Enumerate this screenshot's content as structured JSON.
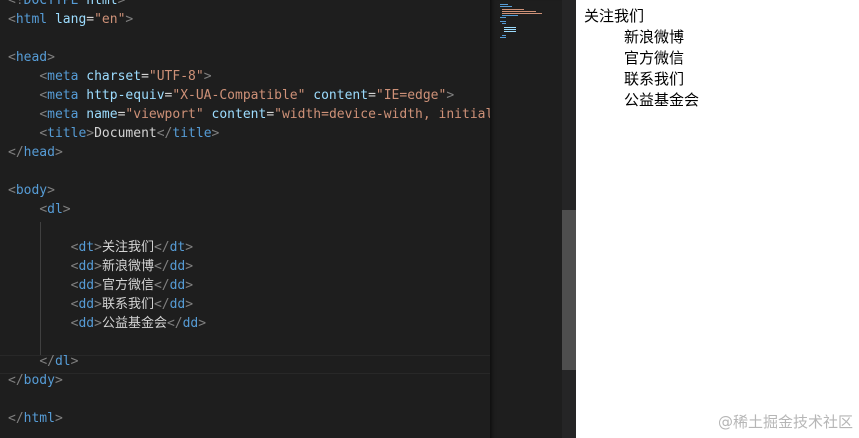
{
  "editor": {
    "lines": [
      [
        {
          "t": "<!",
          "c": "bracket"
        },
        {
          "t": "DOCTYPE",
          "c": "tag"
        },
        {
          "t": " html",
          "c": "attr"
        },
        {
          "t": ">",
          "c": "bracket"
        }
      ],
      [
        {
          "t": "<",
          "c": "bracket"
        },
        {
          "t": "html",
          "c": "tag"
        },
        {
          "t": " lang",
          "c": "attr"
        },
        {
          "t": "=",
          "c": "txt"
        },
        {
          "t": "\"en\"",
          "c": "str"
        },
        {
          "t": ">",
          "c": "bracket"
        }
      ],
      [],
      [
        {
          "t": "<",
          "c": "bracket"
        },
        {
          "t": "head",
          "c": "tag"
        },
        {
          "t": ">",
          "c": "bracket"
        }
      ],
      [
        {
          "t": "    ",
          "c": "txt"
        },
        {
          "t": "<",
          "c": "bracket"
        },
        {
          "t": "meta",
          "c": "tag"
        },
        {
          "t": " charset",
          "c": "attr"
        },
        {
          "t": "=",
          "c": "txt"
        },
        {
          "t": "\"UTF-8\"",
          "c": "str"
        },
        {
          "t": ">",
          "c": "bracket"
        }
      ],
      [
        {
          "t": "    ",
          "c": "txt"
        },
        {
          "t": "<",
          "c": "bracket"
        },
        {
          "t": "meta",
          "c": "tag"
        },
        {
          "t": " http-equiv",
          "c": "attr"
        },
        {
          "t": "=",
          "c": "txt"
        },
        {
          "t": "\"X-UA-Compatible\"",
          "c": "str"
        },
        {
          "t": " content",
          "c": "attr"
        },
        {
          "t": "=",
          "c": "txt"
        },
        {
          "t": "\"IE=edge\"",
          "c": "str"
        },
        {
          "t": ">",
          "c": "bracket"
        }
      ],
      [
        {
          "t": "    ",
          "c": "txt"
        },
        {
          "t": "<",
          "c": "bracket"
        },
        {
          "t": "meta",
          "c": "tag"
        },
        {
          "t": " name",
          "c": "attr"
        },
        {
          "t": "=",
          "c": "txt"
        },
        {
          "t": "\"viewport\"",
          "c": "str"
        },
        {
          "t": " content",
          "c": "attr"
        },
        {
          "t": "=",
          "c": "txt"
        },
        {
          "t": "\"width=device-width, initial-",
          "c": "str"
        }
      ],
      [
        {
          "t": "    ",
          "c": "txt"
        },
        {
          "t": "<",
          "c": "bracket"
        },
        {
          "t": "title",
          "c": "tag"
        },
        {
          "t": ">",
          "c": "bracket"
        },
        {
          "t": "Document",
          "c": "txt"
        },
        {
          "t": "</",
          "c": "bracket"
        },
        {
          "t": "title",
          "c": "tag"
        },
        {
          "t": ">",
          "c": "bracket"
        }
      ],
      [
        {
          "t": "</",
          "c": "bracket"
        },
        {
          "t": "head",
          "c": "tag"
        },
        {
          "t": ">",
          "c": "bracket"
        }
      ],
      [],
      [
        {
          "t": "<",
          "c": "bracket"
        },
        {
          "t": "body",
          "c": "tag"
        },
        {
          "t": ">",
          "c": "bracket"
        }
      ],
      [
        {
          "t": "    ",
          "c": "txt"
        },
        {
          "t": "<",
          "c": "bracket"
        },
        {
          "t": "dl",
          "c": "tag"
        },
        {
          "t": ">",
          "c": "bracket"
        }
      ],
      [],
      [
        {
          "t": "        ",
          "c": "txt"
        },
        {
          "t": "<",
          "c": "bracket"
        },
        {
          "t": "dt",
          "c": "tag"
        },
        {
          "t": ">",
          "c": "bracket"
        },
        {
          "t": "关注我们",
          "c": "txt"
        },
        {
          "t": "</",
          "c": "bracket"
        },
        {
          "t": "dt",
          "c": "tag"
        },
        {
          "t": ">",
          "c": "bracket"
        }
      ],
      [
        {
          "t": "        ",
          "c": "txt"
        },
        {
          "t": "<",
          "c": "bracket"
        },
        {
          "t": "dd",
          "c": "tag"
        },
        {
          "t": ">",
          "c": "bracket"
        },
        {
          "t": "新浪微博",
          "c": "txt"
        },
        {
          "t": "</",
          "c": "bracket"
        },
        {
          "t": "dd",
          "c": "tag"
        },
        {
          "t": ">",
          "c": "bracket"
        }
      ],
      [
        {
          "t": "        ",
          "c": "txt"
        },
        {
          "t": "<",
          "c": "bracket"
        },
        {
          "t": "dd",
          "c": "tag"
        },
        {
          "t": ">",
          "c": "bracket"
        },
        {
          "t": "官方微信",
          "c": "txt"
        },
        {
          "t": "</",
          "c": "bracket"
        },
        {
          "t": "dd",
          "c": "tag"
        },
        {
          "t": ">",
          "c": "bracket"
        }
      ],
      [
        {
          "t": "        ",
          "c": "txt"
        },
        {
          "t": "<",
          "c": "bracket"
        },
        {
          "t": "dd",
          "c": "tag"
        },
        {
          "t": ">",
          "c": "bracket"
        },
        {
          "t": "联系我们",
          "c": "txt"
        },
        {
          "t": "</",
          "c": "bracket"
        },
        {
          "t": "dd",
          "c": "tag"
        },
        {
          "t": ">",
          "c": "bracket"
        }
      ],
      [
        {
          "t": "        ",
          "c": "txt"
        },
        {
          "t": "<",
          "c": "bracket"
        },
        {
          "t": "dd",
          "c": "tag"
        },
        {
          "t": ">",
          "c": "bracket"
        },
        {
          "t": "公益基金会",
          "c": "txt"
        },
        {
          "t": "</",
          "c": "bracket"
        },
        {
          "t": "dd",
          "c": "tag"
        },
        {
          "t": ">",
          "c": "bracket"
        }
      ],
      [],
      [
        {
          "t": "    ",
          "c": "txt"
        },
        {
          "t": "</",
          "c": "bracket"
        },
        {
          "t": "dl",
          "c": "tag"
        },
        {
          "t": ">",
          "c": "bracket"
        }
      ],
      [
        {
          "t": "</",
          "c": "bracket"
        },
        {
          "t": "body",
          "c": "tag"
        },
        {
          "t": ">",
          "c": "bracket"
        }
      ],
      [],
      [
        {
          "t": "</",
          "c": "bracket"
        },
        {
          "t": "html",
          "c": "tag"
        },
        {
          "t": ">",
          "c": "bracket"
        }
      ]
    ],
    "colors": {
      "tag": "#569cd6",
      "bracket": "#808080",
      "attr": "#9cdcfe",
      "string": "#ce9178",
      "text": "#d4d4d4",
      "background": "#1e1e1e"
    }
  },
  "preview": {
    "term": "关注我们",
    "items": [
      "新浪微博",
      "官方微信",
      "联系我们",
      "公益基金会"
    ]
  },
  "watermark": "@稀土掘金技术社区"
}
